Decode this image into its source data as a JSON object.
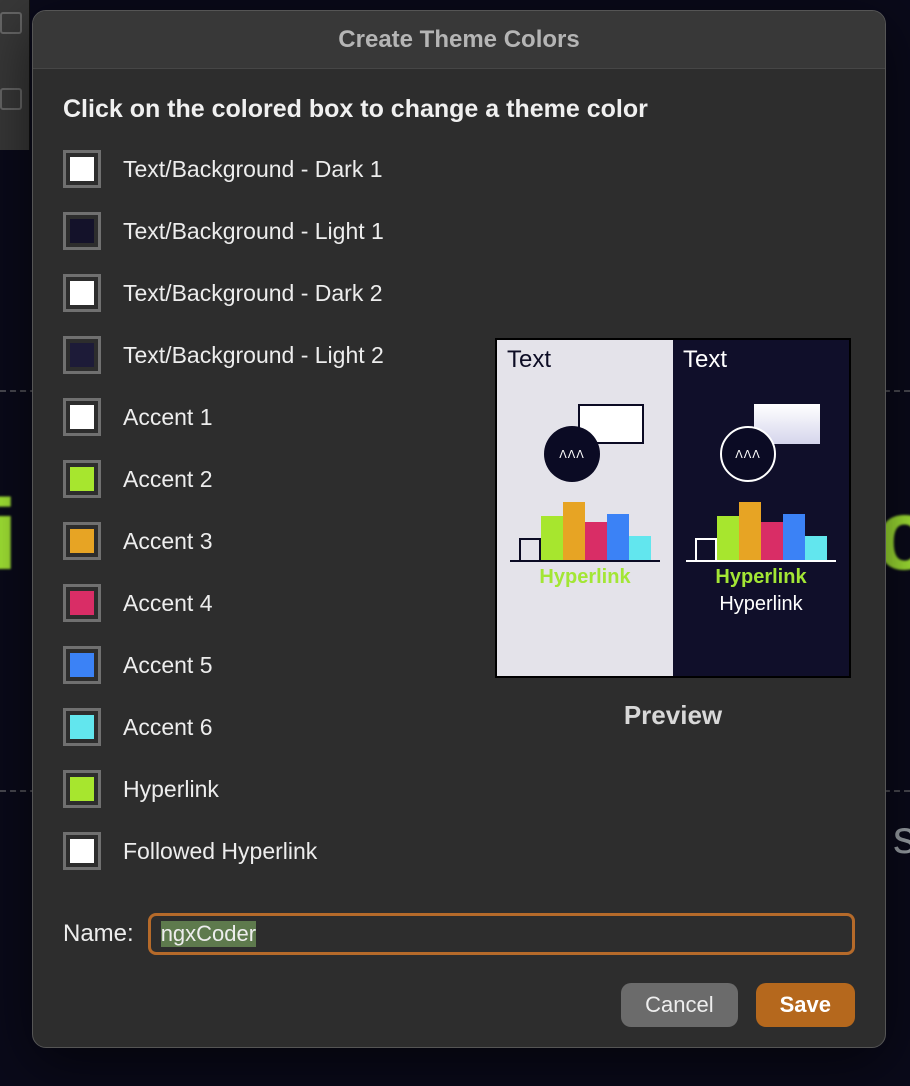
{
  "dialog": {
    "title": "Create Theme Colors",
    "instruction": "Click on the colored box to change a theme color",
    "name_label": "Name:",
    "name_value": "ngxCoder",
    "cancel_label": "Cancel",
    "save_label": "Save"
  },
  "color_slots": [
    {
      "id": "dark1",
      "label": "Text/Background - Dark 1",
      "color": "#ffffff"
    },
    {
      "id": "light1",
      "label": "Text/Background - Light 1",
      "color": "#14122a"
    },
    {
      "id": "dark2",
      "label": "Text/Background - Dark 2",
      "color": "#ffffff"
    },
    {
      "id": "light2",
      "label": "Text/Background - Light 2",
      "color": "#1d1b38"
    },
    {
      "id": "accent1",
      "label": "Accent 1",
      "color": "#ffffff"
    },
    {
      "id": "accent2",
      "label": "Accent 2",
      "color": "#a7e62e"
    },
    {
      "id": "accent3",
      "label": "Accent 3",
      "color": "#e7a424"
    },
    {
      "id": "accent4",
      "label": "Accent 4",
      "color": "#d92d66"
    },
    {
      "id": "accent5",
      "label": "Accent 5",
      "color": "#3b82f6"
    },
    {
      "id": "accent6",
      "label": "Accent 6",
      "color": "#62e6ee"
    },
    {
      "id": "hyperlink",
      "label": "Hyperlink",
      "color": "#a7e62e"
    },
    {
      "id": "followed",
      "label": "Followed Hyperlink",
      "color": "#ffffff"
    }
  ],
  "preview": {
    "label": "Preview",
    "text_label": "Text",
    "hyperlink_label": "Hyperlink",
    "followed_label": "Hyperlink"
  },
  "chart_data": {
    "type": "bar",
    "categories": [
      "Accent 1",
      "Accent 2",
      "Accent 3",
      "Accent 4",
      "Accent 5",
      "Accent 6"
    ],
    "series": [
      {
        "name": "preview-bars",
        "values": [
          22,
          44,
          58,
          38,
          46,
          24
        ]
      }
    ],
    "colors": [
      "#ffffff",
      "#a7e62e",
      "#e7a424",
      "#d92d66",
      "#3b82f6",
      "#62e6ee"
    ],
    "title": "",
    "xlabel": "",
    "ylabel": "",
    "ylim": [
      0,
      60
    ]
  }
}
